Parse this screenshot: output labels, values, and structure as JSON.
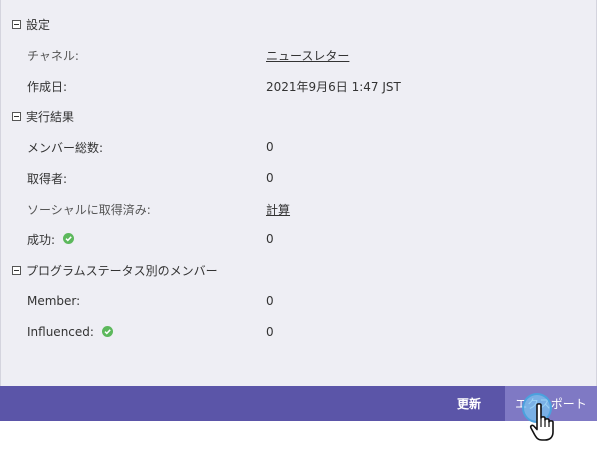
{
  "settings": {
    "title": "設定",
    "channel_label": "チャネル:",
    "channel_value": "ニュースレター",
    "created_label": "作成日:",
    "created_value": "2021年9月6日 1:47 JST"
  },
  "results": {
    "title": "実行結果",
    "members_label": "メンバー総数:",
    "members_value": "0",
    "acquired_label": "取得者:",
    "acquired_value": "0",
    "social_label": "ソーシャルに取得済み:",
    "social_value": "計算",
    "success_label": "成功:",
    "success_value": "0"
  },
  "program_status": {
    "title": "プログラムステータス別のメンバー",
    "member_label": "Member:",
    "member_value": "0",
    "influenced_label": "Influenced:",
    "influenced_value": "0"
  },
  "footer": {
    "refresh_label": "更新",
    "export_label": "エクスポート"
  },
  "colors": {
    "footer_bg": "#5b55a8",
    "export_bg": "#7f79c4",
    "check_green": "#5cb85c"
  }
}
